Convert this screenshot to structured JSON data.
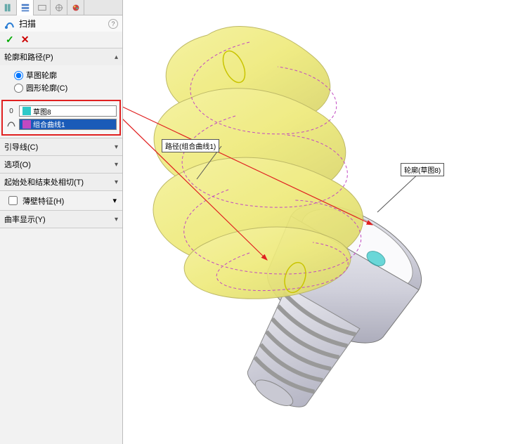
{
  "feature": {
    "title": "扫描"
  },
  "sections": {
    "profilePath": {
      "header": "轮廓和路径(P)",
      "radio1": "草图轮廓",
      "radio2": "圆形轮廓(C)",
      "profileIdx": "0",
      "profileValue": "草图8",
      "pathValue": "组合曲线1"
    },
    "guide": {
      "header": "引导线(C)"
    },
    "options": {
      "header": "选项(O)"
    },
    "tangency": {
      "header": "起始处和结束处相切(T)"
    },
    "thin": {
      "label": "薄壁特征(H)"
    },
    "curvature": {
      "header": "曲率显示(Y)"
    }
  },
  "callouts": {
    "path": "路径(组合曲线1)",
    "profile": "轮廓(草图8)"
  }
}
